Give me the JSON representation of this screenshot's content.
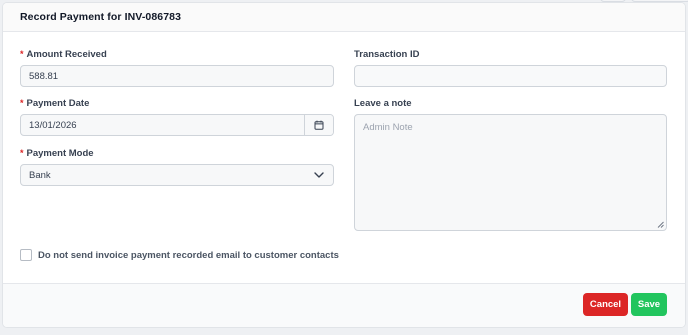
{
  "modal": {
    "title": "Record Payment for INV-086783"
  },
  "form": {
    "amount_received": {
      "label": "Amount Received",
      "required_mark": "*",
      "value": "588.81"
    },
    "payment_date": {
      "label": "Payment Date",
      "required_mark": "*",
      "value": "13/01/2026",
      "icon": "calendar-icon"
    },
    "payment_mode": {
      "label": "Payment Mode",
      "required_mark": "*",
      "selected": "Bank",
      "icon": "chevron-down-icon"
    },
    "transaction_id": {
      "label": "Transaction ID",
      "value": ""
    },
    "note": {
      "label": "Leave a note",
      "placeholder": "Admin Note"
    },
    "no_email_checkbox": {
      "label": "Do not send invoice payment recorded email to customer contacts",
      "checked": false
    }
  },
  "footer": {
    "cancel_label": "Cancel",
    "save_label": "Save"
  },
  "colors": {
    "required": "#dc2626",
    "cancel": "#dc2626",
    "save": "#22c55e"
  }
}
